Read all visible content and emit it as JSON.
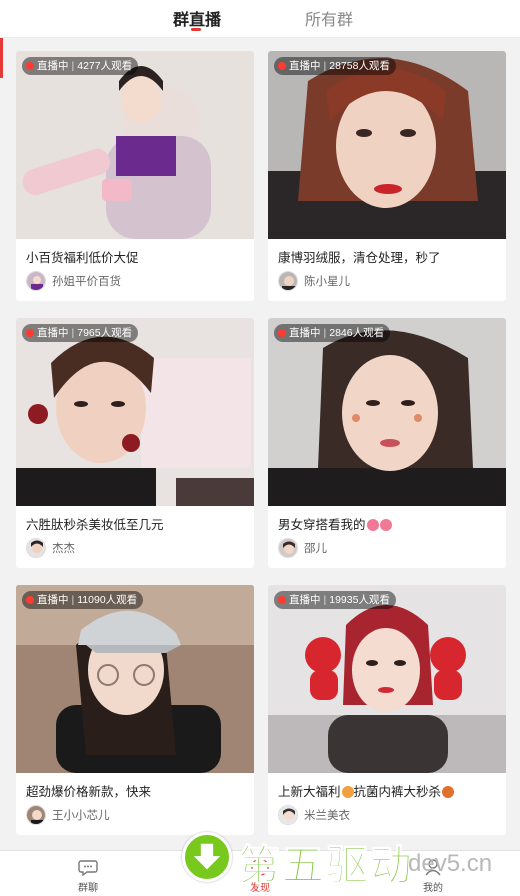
{
  "tabs": [
    {
      "label": "群直播",
      "active": true
    },
    {
      "label": "所有群",
      "active": false
    }
  ],
  "live_tag_label": "直播中",
  "viewer_suffix": "人观看",
  "cards": [
    {
      "viewers": "4277",
      "title": "小百货福利低价大促",
      "host": "孙姐平价百货"
    },
    {
      "viewers": "28758",
      "title": "康博羽绒服，清仓处理，秒了",
      "host": "陈小星儿"
    },
    {
      "viewers": "7965",
      "title": "六胜肽秒杀美妆低至几元",
      "host": "杰杰"
    },
    {
      "viewers": "2846",
      "title": "男女穿搭看我的",
      "host": "邵儿"
    },
    {
      "viewers": "11090",
      "title": "超劲爆价格新款，快来",
      "host": "王小小芯儿"
    },
    {
      "viewers": "19935",
      "title": "上新大福利",
      "title_mid": "抗菌内裤大秒杀",
      "host": "米兰美衣"
    }
  ],
  "bottom_nav": [
    {
      "label": "群聊",
      "icon": "chat-bubble-icon"
    },
    {
      "label": "发现",
      "icon": "discover-icon",
      "active": true
    },
    {
      "label": "我的",
      "icon": "profile-icon"
    }
  ],
  "watermark": {
    "brand": "第五驱动",
    "domain": "dev5.cn"
  },
  "colors": {
    "accent": "#e53935",
    "live_dot": "#ff3b30",
    "watermark_green": "#86c540"
  }
}
